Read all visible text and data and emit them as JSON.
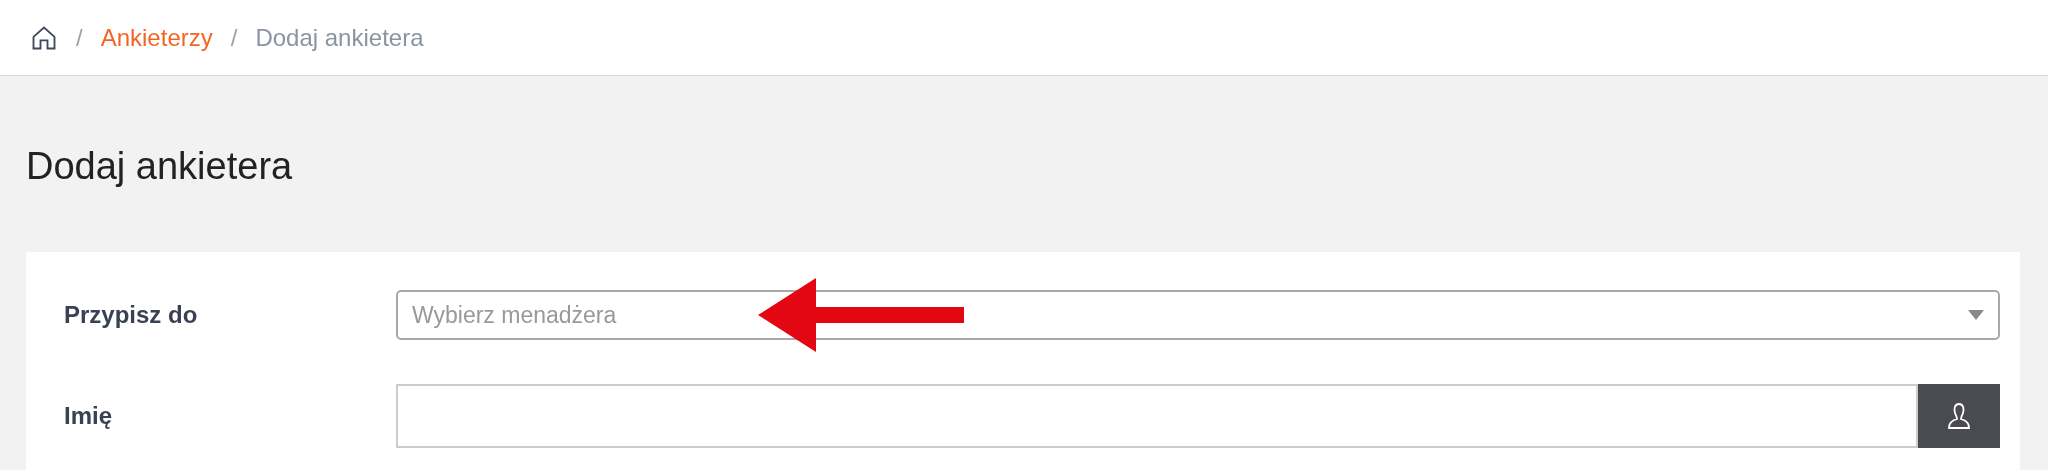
{
  "breadcrumb": {
    "items": [
      {
        "label": "Ankieterzy",
        "kind": "link"
      },
      {
        "label": "Dodaj ankietera",
        "kind": "current"
      }
    ],
    "separator": "/"
  },
  "page_title": "Dodaj ankietera",
  "form": {
    "fields": [
      {
        "kind": "select",
        "label": "Przypisz do",
        "placeholder": "Wybierz menadżera"
      },
      {
        "kind": "text",
        "label": "Imię"
      }
    ]
  }
}
